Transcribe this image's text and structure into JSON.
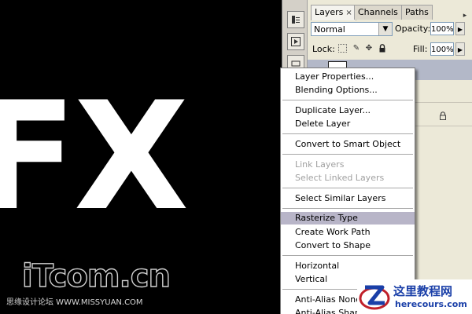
{
  "canvas": {
    "text": "FX"
  },
  "watermark": {
    "logo": "iTcom.cn",
    "line": "思缘设计论坛  WWW.MISSYUAN.COM"
  },
  "panel": {
    "tabs": [
      {
        "label": "Layers",
        "active": true
      },
      {
        "label": "Channels",
        "active": false
      },
      {
        "label": "Paths",
        "active": false
      }
    ],
    "tab_close": "×",
    "blend_mode": "Normal",
    "opacity_label": "Opacity:",
    "opacity_value": "100%",
    "lock_label": "Lock:",
    "fill_label": "Fill:",
    "fill_value": "100%"
  },
  "context_menu": {
    "items": [
      {
        "label": "Layer Properties...",
        "state": "normal"
      },
      {
        "label": "Blending Options...",
        "state": "normal"
      },
      {
        "label": "Duplicate Layer...",
        "state": "normal"
      },
      {
        "label": "Delete Layer",
        "state": "normal"
      },
      {
        "label": "Convert to Smart Object",
        "state": "normal"
      },
      {
        "label": "Link Layers",
        "state": "disabled"
      },
      {
        "label": "Select Linked Layers",
        "state": "disabled"
      },
      {
        "label": "Select Similar Layers",
        "state": "normal"
      },
      {
        "label": "Rasterize Type",
        "state": "highlighted"
      },
      {
        "label": "Create Work Path",
        "state": "normal"
      },
      {
        "label": "Convert to Shape",
        "state": "normal"
      },
      {
        "label": "Horizontal",
        "state": "normal"
      },
      {
        "label": "Vertical",
        "state": "normal"
      },
      {
        "label": "Anti-Alias None",
        "state": "normal"
      },
      {
        "label": "Anti-Alias Sharp",
        "state": "normal"
      }
    ]
  },
  "corner_logo": {
    "cn": "这里教程网",
    "en": "herecours.com"
  },
  "icons": [
    "history-icon",
    "play-action-icon",
    "lock-transparent-icon",
    "brush-lock-icon",
    "move-lock-icon",
    "lock-all-icon",
    "dropdown-arrow-icon",
    "flyout-arrow-icon",
    "z-logo-icon"
  ],
  "colors": {
    "highlight": "#b8b5c8",
    "selected_layer": "#b3b8c8",
    "panel_bg": "#ece9d8",
    "logo_blue": "#1a3fa8"
  }
}
